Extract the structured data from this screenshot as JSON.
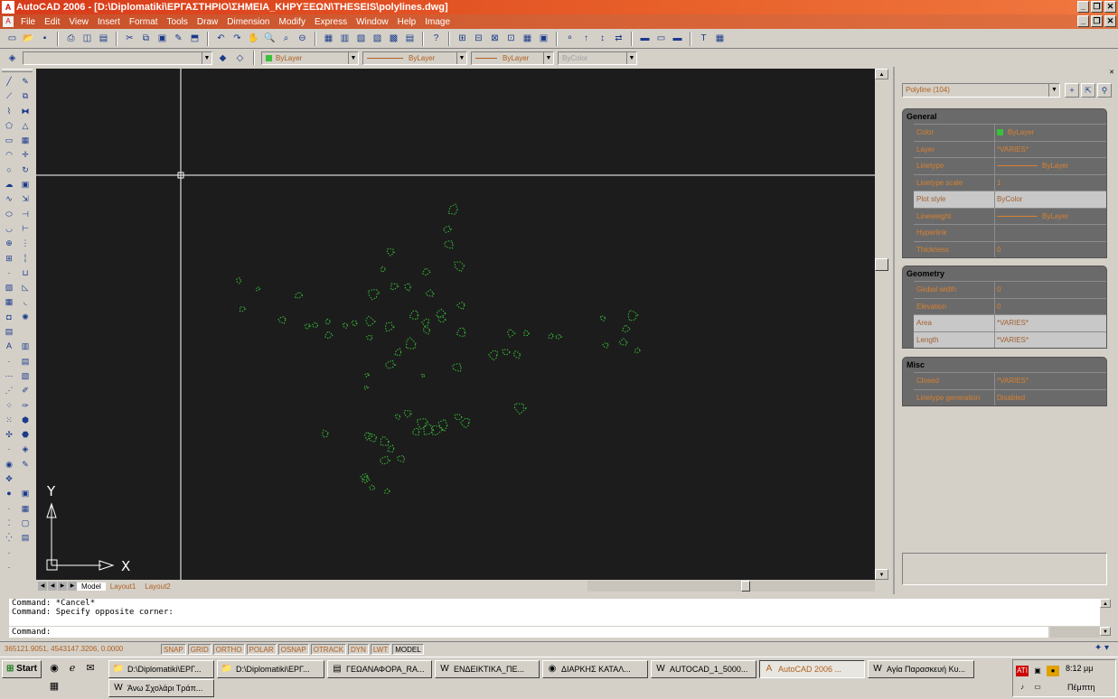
{
  "window": {
    "title": "AutoCAD 2006 - [D:\\Diplomatiki\\ΕΡΓΑΣΤΗΡΙΟ\\ΣΗΜΕΙΑ_ΚΗΡΥΞΕΩΝ\\THESEIS\\polylines.dwg]",
    "minimize": "_",
    "restore": "❐",
    "close": "✕"
  },
  "menu": [
    "File",
    "Edit",
    "View",
    "Insert",
    "Format",
    "Tools",
    "Draw",
    "Dimension",
    "Modify",
    "Express",
    "Window",
    "Help",
    "Image"
  ],
  "layers_toolbar": {
    "color_value": "ByLayer",
    "linetype_value": "ByLayer",
    "lineweight_value": "ByLayer",
    "plotstyle_value": "ByColor"
  },
  "layout_tabs": [
    "Model",
    "Layout1",
    "Layout2"
  ],
  "ucs": {
    "x_label": "X",
    "y_label": "Y"
  },
  "properties": {
    "selection": "Polyline (104)",
    "sections": [
      {
        "title": "General",
        "rows": [
          {
            "key": "Color",
            "value": "ByLayer",
            "swatch": true
          },
          {
            "key": "Layer",
            "value": "*VARIES*"
          },
          {
            "key": "Linetype",
            "value": "ByLayer",
            "line": true
          },
          {
            "key": "Linetype scale",
            "value": "1"
          },
          {
            "key": "Plot style",
            "value": "ByColor",
            "highlight": true
          },
          {
            "key": "Lineweight",
            "value": "ByLayer",
            "line": true
          },
          {
            "key": "Hyperlink",
            "value": ""
          },
          {
            "key": "Thickness",
            "value": "0"
          }
        ]
      },
      {
        "title": "Geometry",
        "rows": [
          {
            "key": "Global width",
            "value": "0"
          },
          {
            "key": "Elevation",
            "value": "0"
          },
          {
            "key": "Area",
            "value": "*VARIES*",
            "highlight": true
          },
          {
            "key": "Length",
            "value": "*VARIES*",
            "highlight": true
          }
        ]
      },
      {
        "title": "Misc",
        "rows": [
          {
            "key": "Closed",
            "value": "*VARIES*"
          },
          {
            "key": "Linetype generation",
            "value": "Disabled"
          }
        ]
      }
    ]
  },
  "command": {
    "history": [
      "Command: *Cancel*",
      "Command: Specify opposite corner:"
    ],
    "prompt": "Command:"
  },
  "status": {
    "coords": "365121.9051, 4543147.3206, 0.0000",
    "toggles": [
      "SNAP",
      "GRID",
      "ORTHO",
      "POLAR",
      "OSNAP",
      "OTRACK",
      "DYN",
      "LWT",
      "MODEL"
    ]
  },
  "taskbar": {
    "start": "Start",
    "tasks_row1": [
      {
        "label": "D:\\Diplomatiki\\ΕΡΓ...",
        "icon": "folder-icon"
      },
      {
        "label": "D:\\Diplomatiki\\ΕΡΓ...",
        "icon": "folder-icon"
      },
      {
        "label": "ΓΕΩΑΝΑΦΟΡΑ_RA...",
        "icon": "app-icon"
      },
      {
        "label": "ΕΝΔΕΙΚΤΙΚΑ_ΠΕ...",
        "icon": "word-icon"
      },
      {
        "label": "ΔΙΑΡΚΗΣ ΚΑΤΑΛ...",
        "icon": "firefox-icon"
      },
      {
        "label": "AUTOCAD_1_5000...",
        "icon": "word-icon"
      },
      {
        "label": "AutoCAD 2006 ...",
        "icon": "autocad-icon",
        "active": true
      },
      {
        "label": "Αγία Παρασκευή Κυ...",
        "icon": "word-icon"
      }
    ],
    "tasks_row2": [
      {
        "label": "Άνω Σχολάρι Τράπ...",
        "icon": "word-icon"
      }
    ],
    "clock": "8:12 μμ",
    "day": "Πέμπτη"
  },
  "colors": {
    "drawing_bg": "#1c1c1c",
    "polyline": "#3ac03a",
    "crosshair": "#ffffff"
  }
}
